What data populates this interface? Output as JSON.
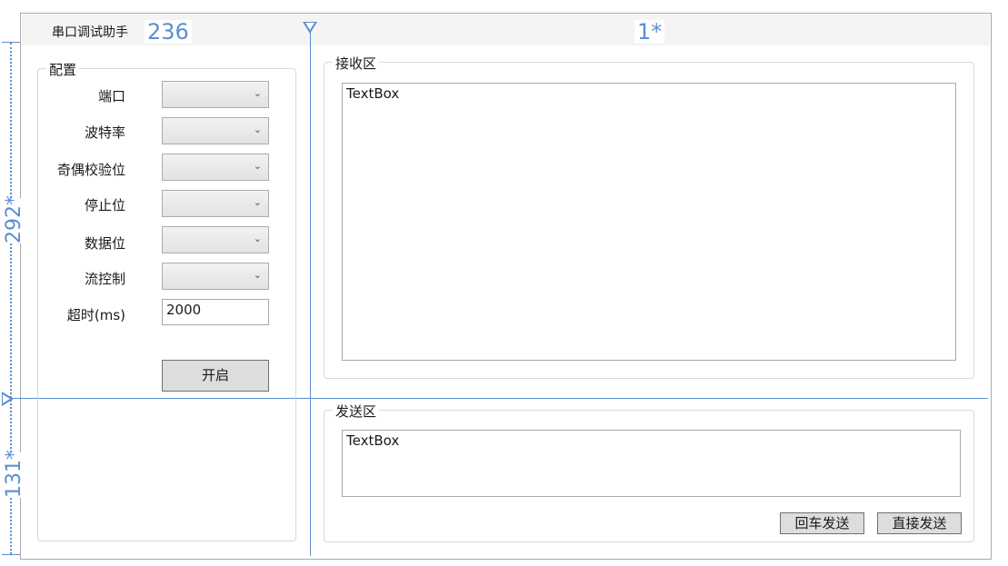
{
  "window": {
    "title": "串口调试助手"
  },
  "design": {
    "col0_width": "236",
    "col1_width": "1*",
    "row0_height": "292*",
    "row1_height": "131*",
    "accent": "#5b8fd0"
  },
  "config": {
    "legend": "配置",
    "fields": [
      {
        "label": "端口",
        "value": ""
      },
      {
        "label": "波特率",
        "value": ""
      },
      {
        "label": "奇偶校验位",
        "value": ""
      },
      {
        "label": "停止位",
        "value": ""
      },
      {
        "label": "数据位",
        "value": ""
      },
      {
        "label": "流控制",
        "value": ""
      }
    ],
    "timeout_label": "超时(ms)",
    "timeout_value": "2000",
    "open_button": "开启"
  },
  "receive": {
    "legend": "接收区",
    "text": "TextBox"
  },
  "send": {
    "legend": "发送区",
    "text": "TextBox",
    "send_enter_button": "回车发送",
    "send_direct_button": "直接发送"
  }
}
